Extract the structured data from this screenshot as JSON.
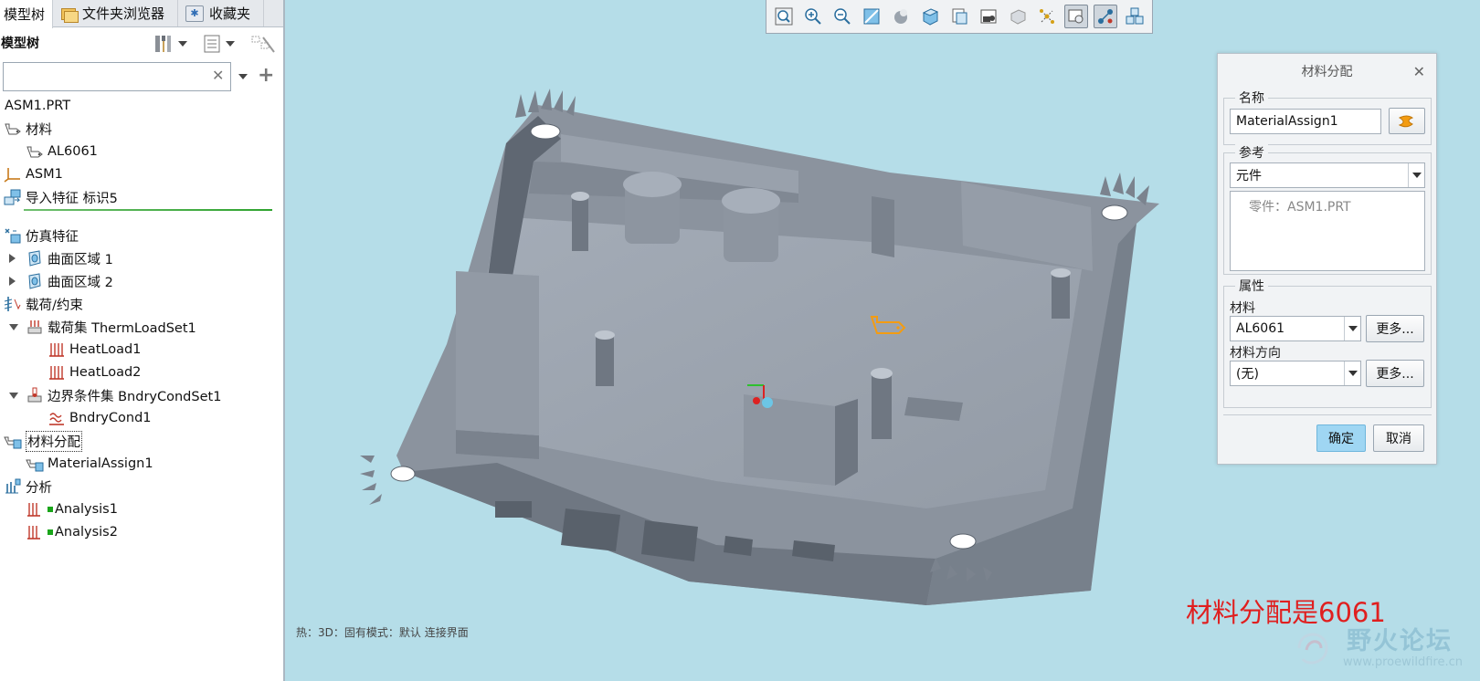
{
  "tabs": [
    {
      "label": "模型树",
      "active": true
    },
    {
      "label": "文件夹浏览器",
      "active": false
    },
    {
      "label": "收藏夹",
      "active": false
    }
  ],
  "tree_header": {
    "title": "模型树"
  },
  "search": {
    "value": "",
    "placeholder": ""
  },
  "tree": {
    "root": "ASM1.PRT",
    "items": [
      {
        "label": "材料"
      },
      {
        "label": "AL6061"
      },
      {
        "label": "ASM1"
      },
      {
        "label": "导入特征 标识5"
      },
      {
        "label": "仿真特征"
      },
      {
        "label": "曲面区域 1"
      },
      {
        "label": "曲面区域 2"
      },
      {
        "label": "载荷/约束"
      },
      {
        "label": "载荷集 ThermLoadSet1"
      },
      {
        "label": "HeatLoad1"
      },
      {
        "label": "HeatLoad2"
      },
      {
        "label": "边界条件集 BndryCondSet1"
      },
      {
        "label": "BndryCond1"
      },
      {
        "label": "材料分配"
      },
      {
        "label": "MaterialAssign1"
      },
      {
        "label": "分析"
      },
      {
        "label": "Analysis1"
      },
      {
        "label": "Analysis2"
      }
    ]
  },
  "toolbar": {
    "icons": [
      "zoom-fit-icon",
      "zoom-in-icon",
      "zoom-out-icon",
      "repaint-icon",
      "display-style-icon",
      "saved-orientation-icon",
      "view-manager-icon",
      "perspective-icon",
      "shade-icon",
      "datum-display-icon",
      "model-display-icon",
      "spin-center-icon",
      "annotation-display-icon"
    ]
  },
  "dialog": {
    "title": "材料分配",
    "name_group": "名称",
    "name_value": "MaterialAssign1",
    "ref_group": "参考",
    "ref_type": "元件",
    "ref_item": "零件：ASM1.PRT",
    "props_group": "属性",
    "material_label": "材料",
    "material_value": "AL6061",
    "more1": "更多...",
    "orient_label": "材料方向",
    "orient_value": "(无)",
    "more2": "更多...",
    "ok": "确定",
    "cancel": "取消"
  },
  "viewport": {
    "status": "热：3D：固有模式：默认 连接界面",
    "annotation": "材料分配是6061",
    "watermark_title": "野火论坛",
    "watermark_url": "www.proewildfire.cn"
  },
  "colors": {
    "background": "#b5dde8",
    "model": "#9aa3b0",
    "annotation": "#e01f1f",
    "ok_button": "#9fd6f3"
  }
}
